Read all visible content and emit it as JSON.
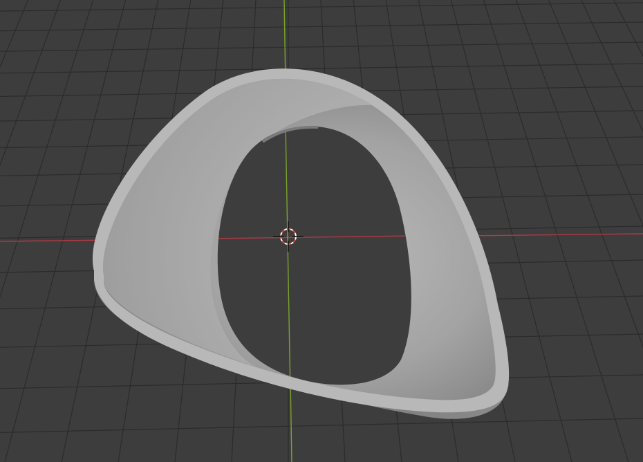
{
  "viewport": {
    "background_color": "#3d3d3d",
    "grid_line_color": "#2b2b2b",
    "x_axis_color": "#b03a46",
    "y_axis_color": "#7aa32f"
  },
  "object": {
    "mesh_color": "#9c9c9c",
    "rim_color": "#bdbdbd",
    "inner_wall_color": "#8f8f8f"
  },
  "cursor": {
    "icon": "3d-cursor-icon",
    "ring_color_a": "#ffffff",
    "ring_color_b": "#d84a3a"
  }
}
